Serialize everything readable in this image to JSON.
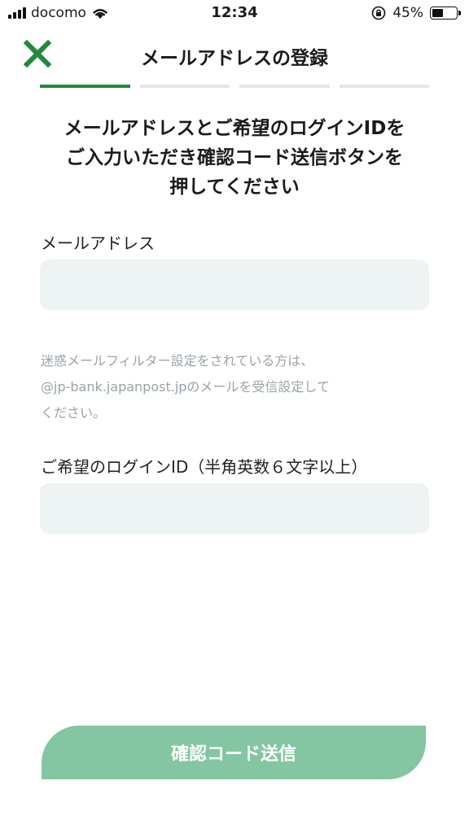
{
  "status_bar": {
    "carrier": "docomo",
    "time": "12:34",
    "battery_percent": "45%",
    "battery_level": 0.45
  },
  "header": {
    "title": "メールアドレスの登録"
  },
  "steps": {
    "total": 4,
    "current": 1
  },
  "instruction": "メールアドレスとご希望のログインIDを\nご入力いただき確認コード送信ボタンを\n押してください",
  "email_field": {
    "label": "メールアドレス",
    "value": "",
    "placeholder": ""
  },
  "note": "迷惑メールフィルター設定をされている方は、\n@jp-bank.japanpost.jpのメールを受信設定して\nください。",
  "login_id_field": {
    "label": "ご希望のログインID（半角英数６文字以上）",
    "value": "",
    "placeholder": ""
  },
  "submit_button": {
    "label": "確認コード送信"
  },
  "colors": {
    "accent": "#1f8a3b",
    "button_disabled": "#83c6a1",
    "input_bg": "#eef3f3",
    "note_text": "#9aa3a8"
  },
  "icons": {
    "close": "close-icon",
    "wifi": "wifi-icon",
    "rotation_lock": "rotation-lock-icon",
    "signal": "signal-icon",
    "battery": "battery-icon"
  }
}
